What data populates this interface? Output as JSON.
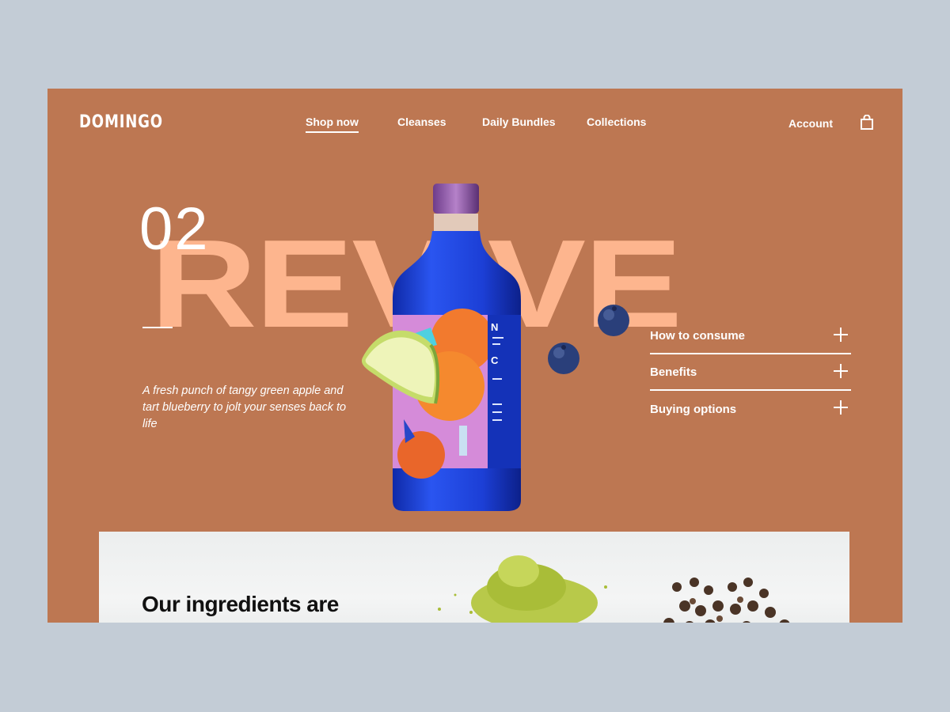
{
  "brand": "DOMINGO",
  "nav": {
    "items": [
      {
        "label": "Shop now",
        "active": true
      },
      {
        "label": "Cleanses",
        "active": false
      },
      {
        "label": "Daily Bundles",
        "active": false
      },
      {
        "label": "Collections",
        "active": false
      }
    ],
    "account_label": "Account"
  },
  "hero": {
    "number": "02",
    "product_word": "REVIVE",
    "tagline": "A fresh punch of tangy green apple and tart blueberry to jolt your senses back to life",
    "accordion": [
      {
        "label": "How to consume"
      },
      {
        "label": "Benefits"
      },
      {
        "label": "Buying options"
      }
    ]
  },
  "ingredients": {
    "heading": "Our ingredients are"
  },
  "colors": {
    "background": "#bd7752",
    "accent_word": "#fdb58e",
    "bottle": "#1c3fd6",
    "page_bg": "#c3ccd6"
  },
  "icons": [
    "shopping-bag-icon",
    "plus-icon"
  ]
}
